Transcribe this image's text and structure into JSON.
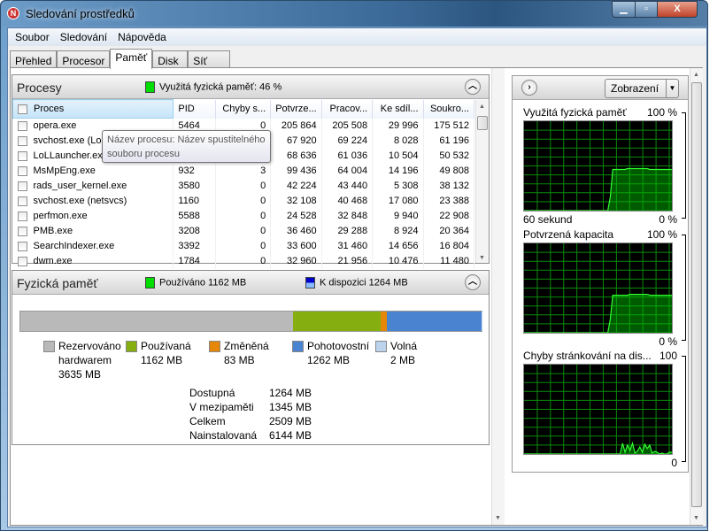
{
  "window": {
    "title": "Sledování prostředků",
    "minimize": "▁",
    "maximize": "▫",
    "close": "X"
  },
  "menu": [
    "Soubor",
    "Sledování",
    "Nápověda"
  ],
  "tabs": [
    "Přehled",
    "Procesor",
    "Paměť",
    "Disk",
    "Síť"
  ],
  "active_tab": "Paměť",
  "processes": {
    "title": "Procesy",
    "indicator": "Využitá fyzická paměť: 46 %",
    "columns": [
      "Proces",
      "PID",
      "Chyby s...",
      "Potvrze...",
      "Pracov...",
      "Ke sdíl...",
      "Soukro..."
    ],
    "rows": [
      [
        "opera.exe",
        "5464",
        "0",
        "205 864",
        "205 508",
        "29 996",
        "175 512"
      ],
      [
        "svchost.exe (LocalSystemNetworkRestricted)",
        "1000",
        "0",
        "67 920",
        "69 224",
        "8 028",
        "61 196"
      ],
      [
        "LoLLauncher.exe",
        "5604",
        "0",
        "68 636",
        "61 036",
        "10 504",
        "50 532"
      ],
      [
        "MsMpEng.exe",
        "932",
        "3",
        "99 436",
        "64 004",
        "14 196",
        "49 808"
      ],
      [
        "rads_user_kernel.exe",
        "3580",
        "0",
        "42 224",
        "43 440",
        "5 308",
        "38 132"
      ],
      [
        "svchost.exe (netsvcs)",
        "1160",
        "0",
        "32 108",
        "40 468",
        "17 080",
        "23 388"
      ],
      [
        "perfmon.exe",
        "5588",
        "0",
        "24 528",
        "32 848",
        "9 940",
        "22 908"
      ],
      [
        "PMB.exe",
        "3208",
        "0",
        "36 460",
        "29 288",
        "8 924",
        "20 364"
      ],
      [
        "SearchIndexer.exe",
        "3392",
        "0",
        "33 600",
        "31 460",
        "14 656",
        "16 804"
      ],
      [
        "dwm.exe",
        "1784",
        "0",
        "32 960",
        "21 956",
        "10 476",
        "11 480"
      ]
    ],
    "tooltip": "Název procesu: Název spustitelného souboru procesu"
  },
  "memory": {
    "title": "Fyzická paměť",
    "used_label": "Používáno 1162 MB",
    "available_label": "K dispozici 1264 MB",
    "segments": [
      {
        "name": "Rezervováno hardwarem",
        "value_mb": 3635,
        "label": "Rezervováno hardwarem",
        "value": "3635 MB",
        "color": "#b9b9b9"
      },
      {
        "name": "Používaná",
        "value_mb": 1162,
        "label": "Používaná",
        "value": "1162 MB",
        "color": "#85ae10"
      },
      {
        "name": "Změněná",
        "value_mb": 83,
        "label": "Změněná",
        "value": "83 MB",
        "color": "#e6870a"
      },
      {
        "name": "Pohotovostní",
        "value_mb": 1262,
        "label": "Pohotovostní",
        "value": "1262 MB",
        "color": "#4a83cf"
      },
      {
        "name": "Volná",
        "value_mb": 2,
        "label": "Volná",
        "value": "2 MB",
        "color": "#bcd3ee"
      }
    ],
    "stats": [
      {
        "k": "Dostupná",
        "v": "1264 MB"
      },
      {
        "k": "V mezipaměti",
        "v": "1345 MB"
      },
      {
        "k": "Celkem",
        "v": "2509 MB"
      },
      {
        "k": "Nainstalovaná",
        "v": "6144 MB"
      }
    ]
  },
  "graphs_pane": {
    "view_button": "Zobrazení",
    "graphs": [
      {
        "title": "Využitá fyzická paměť",
        "max": "100 %",
        "min": "0 %",
        "time": "60 sekund",
        "values": [
          0,
          0,
          0,
          0,
          0,
          0,
          0,
          0,
          0,
          0,
          0,
          0,
          0,
          0,
          0,
          0,
          0,
          0,
          0,
          0,
          0,
          0,
          0,
          0,
          0,
          0,
          0,
          0,
          0,
          0,
          0,
          0,
          0,
          0,
          0,
          15,
          46,
          46,
          46,
          46,
          46,
          46,
          47,
          47,
          47,
          47,
          47,
          47,
          47,
          47,
          47,
          46,
          46,
          46,
          46,
          46,
          46,
          46,
          46,
          46,
          46
        ]
      },
      {
        "title": "Potvrzená kapacita",
        "max": "100 %",
        "min": "0 %",
        "values": [
          0,
          0,
          0,
          0,
          0,
          0,
          0,
          0,
          0,
          0,
          0,
          0,
          0,
          0,
          0,
          0,
          0,
          0,
          0,
          0,
          0,
          0,
          0,
          0,
          0,
          0,
          0,
          0,
          0,
          0,
          0,
          0,
          0,
          0,
          0,
          15,
          42,
          42,
          42,
          42,
          42,
          42,
          42,
          43,
          43,
          43,
          43,
          43,
          43,
          43,
          43,
          42,
          42,
          42,
          42,
          42,
          42,
          42,
          42,
          42,
          42
        ]
      },
      {
        "title": "Chyby stránkování na dis...",
        "max": "100",
        "min": "0",
        "values": [
          0,
          0,
          0,
          0,
          0,
          0,
          0,
          0,
          0,
          0,
          0,
          0,
          0,
          0,
          0,
          0,
          0,
          0,
          0,
          0,
          0,
          0,
          0,
          0,
          0,
          0,
          0,
          0,
          0,
          0,
          0,
          0,
          0,
          0,
          0,
          0,
          0,
          0,
          0,
          0,
          12,
          2,
          10,
          4,
          12,
          1,
          3,
          8,
          2,
          11,
          6,
          10,
          1,
          3,
          2,
          0,
          1,
          0,
          0,
          2,
          2
        ]
      }
    ]
  }
}
